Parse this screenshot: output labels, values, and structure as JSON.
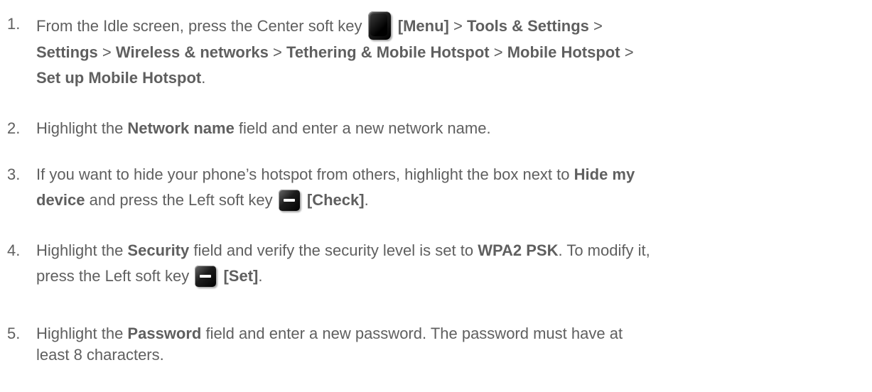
{
  "steps": [
    {
      "number": "1.",
      "t1": "From the Idle screen, press the Center soft key ",
      "menu": "[Menu]",
      "sep": ">",
      "tools": "Tools & Settings",
      "settings": "Settings",
      "wireless": "Wireless & networks",
      "tethering": "Tethering & Mobile Hotspot",
      "hotspot": "Mobile Hotspot",
      "setup": "Set up Mobile Hotspot",
      "end": "."
    },
    {
      "number": "2.",
      "t1": "Highlight the ",
      "b1": "Network name",
      "t2": " field and enter a new network name."
    },
    {
      "number": "3.",
      "t1": "If you want to hide your phone’s hotspot from others, highlight the box next to ",
      "b1": "Hide my",
      "b2": "device",
      "t2": " and press the Left soft key ",
      "b3": "[Check]",
      "end": "."
    },
    {
      "number": "4.",
      "t1": "Highlight the ",
      "b1": "Security",
      "t2": " field and verify the security level is set to ",
      "b2": "WPA2 PSK",
      "t3": ". To modify it,",
      "t4": "press the Left soft key ",
      "b3": "[Set]",
      "end": "."
    },
    {
      "number": "5.",
      "t1": "Highlight the ",
      "b1": "Password",
      "t2": " field and enter a new password. The password must have at",
      "t3": "least 8 characters."
    }
  ],
  "icons": {
    "center_key": "center-soft-key-icon",
    "left_key": "left-soft-key-icon"
  },
  "colors": {
    "text": "#5f5f5f",
    "key": "#111111"
  }
}
